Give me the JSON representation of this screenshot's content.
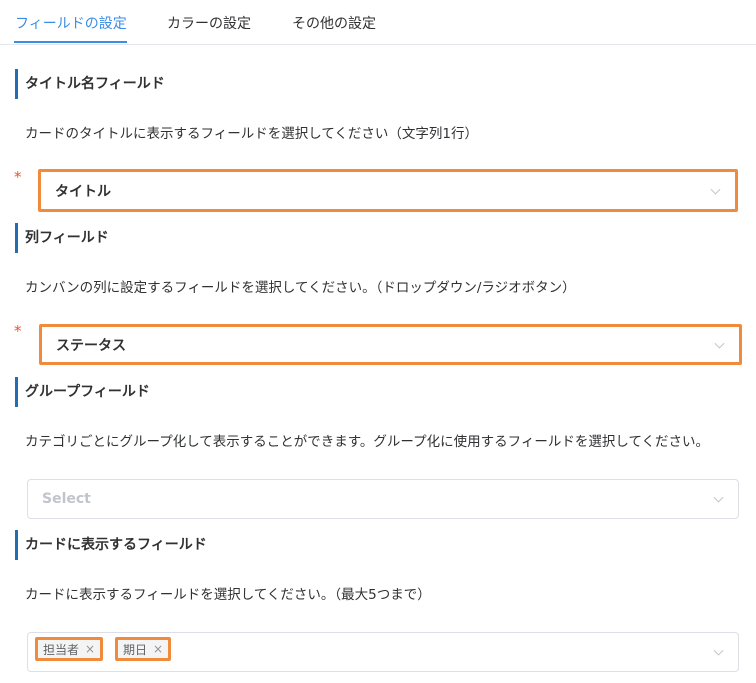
{
  "tabs": [
    {
      "label": "フィールドの設定",
      "active": true
    },
    {
      "label": "カラーの設定",
      "active": false
    },
    {
      "label": "その他の設定",
      "active": false
    }
  ],
  "sections": {
    "title_field": {
      "heading": "タイトル名フィールド",
      "description": "カードのタイトルに表示するフィールドを選択してください（文字列1行）",
      "required_mark": "*",
      "selected": "タイトル"
    },
    "column_field": {
      "heading": "列フィールド",
      "description": "カンバンの列に設定するフィールドを選択してください。（ドロップダウン/ラジオボタン）",
      "required_mark": "*",
      "selected": "ステータス"
    },
    "group_field": {
      "heading": "グループフィールド",
      "description": "カテゴリごとにグループ化して表示することができます。グループ化に使用するフィールドを選択してください。",
      "placeholder": "Select"
    },
    "card_fields": {
      "heading": "カードに表示するフィールド",
      "description": "カードに表示するフィールドを選択してください。（最大5つまで）",
      "tags": [
        "担当者",
        "期日"
      ],
      "tag_close": "×"
    }
  },
  "colors": {
    "accent": "#3a8ee6",
    "highlight": "#f08a3c",
    "section_bar": "#1f6fb2",
    "required": "#e4572e"
  }
}
